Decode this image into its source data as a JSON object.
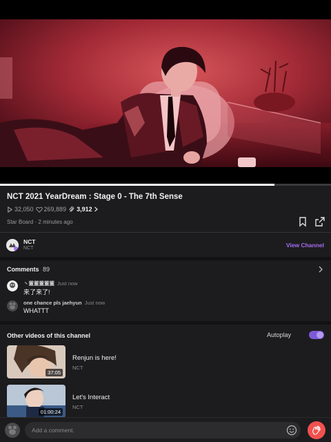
{
  "video": {
    "progress_fraction": 0.83
  },
  "info": {
    "title": "NCT 2021 YearDream : Stage 0 - The 7th Sense",
    "plays": "32,050",
    "likes": "269,889",
    "cheers": "3,912",
    "board": "Star Board",
    "separator": "·",
    "posted": "2 minutes ago"
  },
  "channel": {
    "name": "NCT",
    "sub": "NCT",
    "view_label": "View Channel"
  },
  "comments": {
    "label": "Comments",
    "count": "89",
    "items": [
      {
        "user": "丶董董董董董",
        "time": "Just now",
        "text": "来了来了!"
      },
      {
        "user": "one chance pls jaehyun",
        "time": "Just now",
        "text": "WHATTT"
      }
    ]
  },
  "other_videos": {
    "label": "Other videos of this channel",
    "autoplay_label": "Autoplay",
    "autoplay_on": true,
    "items": [
      {
        "title": "Renjun is here!",
        "channel": "NCT",
        "duration": "37:05"
      },
      {
        "title": "Let's Interact",
        "channel": "NCT",
        "duration": "01:00:24"
      }
    ]
  },
  "composer": {
    "placeholder": "Add a comment."
  },
  "colors": {
    "accent": "#a56cf0",
    "cheer": "#f0514f",
    "background": "#1c1c1e"
  },
  "icons": [
    "play-icon",
    "heart-icon",
    "cheer-icon",
    "chevron-right-icon",
    "bookmark-icon",
    "share-icon",
    "emoji-icon",
    "clap-hand-icon"
  ]
}
